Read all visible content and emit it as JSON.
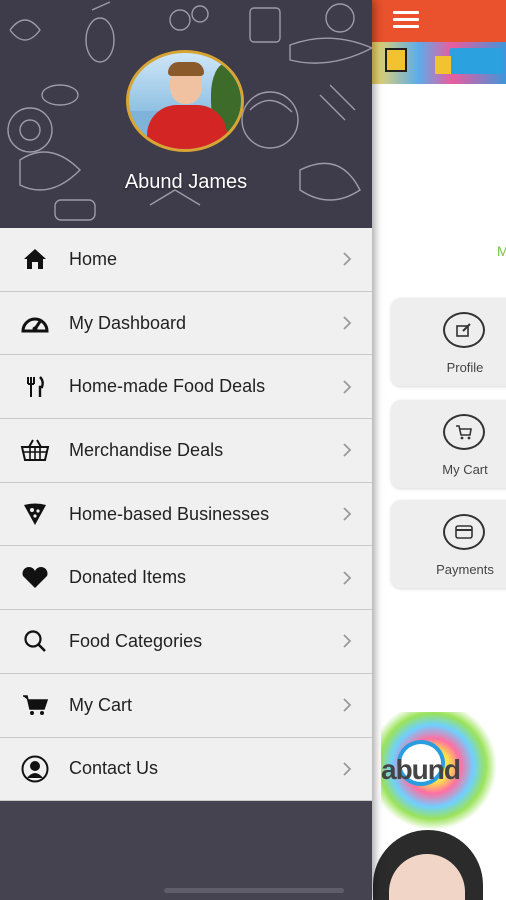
{
  "profile": {
    "name": "Abund James"
  },
  "menu": {
    "items": [
      {
        "label": "Home",
        "icon": "home-icon"
      },
      {
        "label": "My Dashboard",
        "icon": "dashboard-icon"
      },
      {
        "label": "Home-made Food Deals",
        "icon": "fork-knife-icon"
      },
      {
        "label": "Merchandise Deals",
        "icon": "basket-icon"
      },
      {
        "label": "Home-based Businesses",
        "icon": "pizza-slice-icon"
      },
      {
        "label": "Donated Items",
        "icon": "heart-icon"
      },
      {
        "label": "Food Categories",
        "icon": "search-icon"
      },
      {
        "label": "My Cart",
        "icon": "cart-icon"
      },
      {
        "label": "Contact Us",
        "icon": "user-circle-icon"
      }
    ]
  },
  "content": {
    "cards": [
      {
        "label": "Profile",
        "icon": "edit-icon"
      },
      {
        "label": "My Cart",
        "icon": "cart-icon"
      },
      {
        "label": "Payments",
        "icon": "card-icon"
      }
    ],
    "partial_text": "M",
    "logo_text": "abund"
  },
  "colors": {
    "topbar": "#e9522c",
    "drawer": "#45434f",
    "menu_bg": "#f0f0f0",
    "avatar_ring": "#d9a532",
    "accent_green": "#78c23e"
  }
}
